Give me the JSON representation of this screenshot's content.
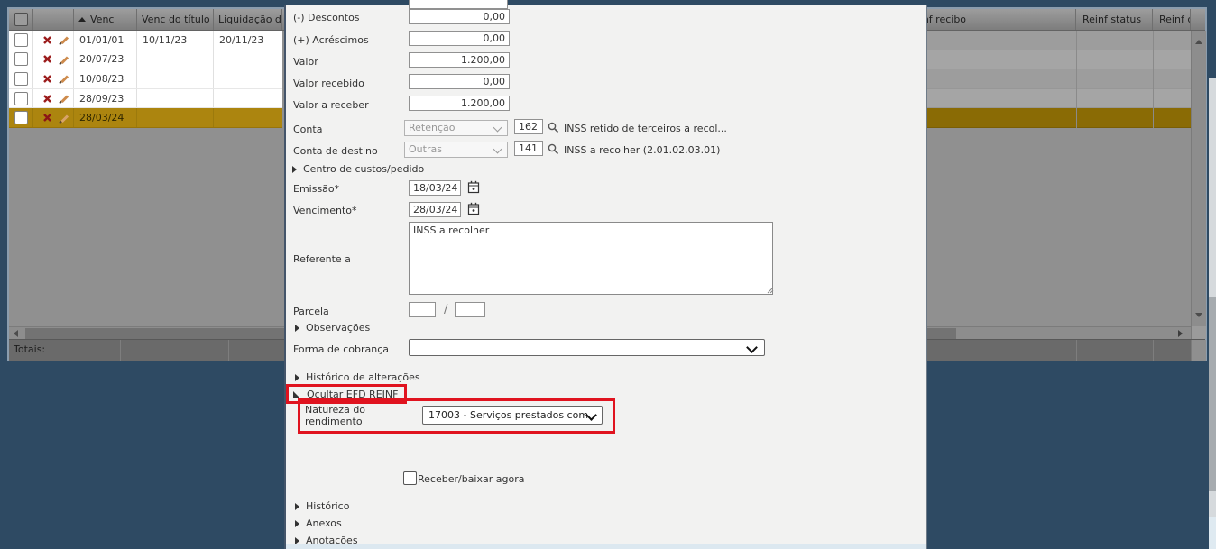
{
  "colors": {
    "background": "#2e4a63",
    "selected_row": "#ac850f",
    "selected_row_dimmed": "#8a6b05",
    "annotation_red": "#e0131f"
  },
  "grid": {
    "header": {
      "venc": "Venc",
      "venc_do_titulo": "Venc do título",
      "liquidacao": "Liquidação d",
      "reinf_recibo": "einf recibo",
      "reinf_status": "Reinf status",
      "reinf_c": "Reinf c"
    },
    "rows": [
      {
        "venc": "01/01/01",
        "venc_do_titulo": "10/11/23",
        "liquidacao": "20/11/23"
      },
      {
        "venc": "20/07/23",
        "venc_do_titulo": "",
        "liquidacao": ""
      },
      {
        "venc": "10/08/23",
        "venc_do_titulo": "",
        "liquidacao": ""
      },
      {
        "venc": "28/09/23",
        "venc_do_titulo": "",
        "liquidacao": ""
      },
      {
        "venc": "28/03/24",
        "venc_do_titulo": "",
        "liquidacao": ""
      }
    ],
    "totals_label": "Totais:"
  },
  "form": {
    "descontos": {
      "label": "(-) Descontos",
      "value": "0,00"
    },
    "acrescimos": {
      "label": "(+) Acréscimos",
      "value": "0,00"
    },
    "valor": {
      "label": "Valor",
      "value": "1.200,00"
    },
    "valor_recebido": {
      "label": "Valor recebido",
      "value": "0,00"
    },
    "valor_a_receber": {
      "label": "Valor a receber",
      "value": "1.200,00"
    },
    "conta": {
      "label": "Conta",
      "tipo": "Retenção",
      "codigo": "162",
      "descricao": "INSS retido de terceiros a recol..."
    },
    "conta_destino": {
      "label": "Conta de destino",
      "tipo": "Outras",
      "codigo": "141",
      "descricao": "INSS a recolher (2.01.02.03.01)"
    },
    "centro_custos": {
      "label": "Centro de custos/pedido"
    },
    "emissao": {
      "label": "Emissão*",
      "value": "18/03/24"
    },
    "vencimento": {
      "label": "Vencimento*",
      "value": "28/03/24"
    },
    "referente": {
      "label": "Referente a",
      "value": "INSS a recolher"
    },
    "parcela": {
      "label": "Parcela",
      "value1": "",
      "value2": "",
      "separator": "/"
    },
    "observacoes": {
      "label": "Observações"
    },
    "forma_cobranca": {
      "label": "Forma de cobrança",
      "value": ""
    },
    "historico_alteracoes": {
      "label": "Histórico de alterações"
    },
    "efd_reinf": {
      "label": "Ocultar EFD REINF"
    },
    "natureza": {
      "label": "Natureza do rendimento",
      "value": "17003 - Serviços prestados com"
    },
    "receber_agora": {
      "label": "Receber/baixar agora"
    },
    "historico": {
      "label": "Histórico"
    },
    "anexos": {
      "label": "Anexos"
    },
    "anotacoes": {
      "label": "Anotações"
    }
  }
}
